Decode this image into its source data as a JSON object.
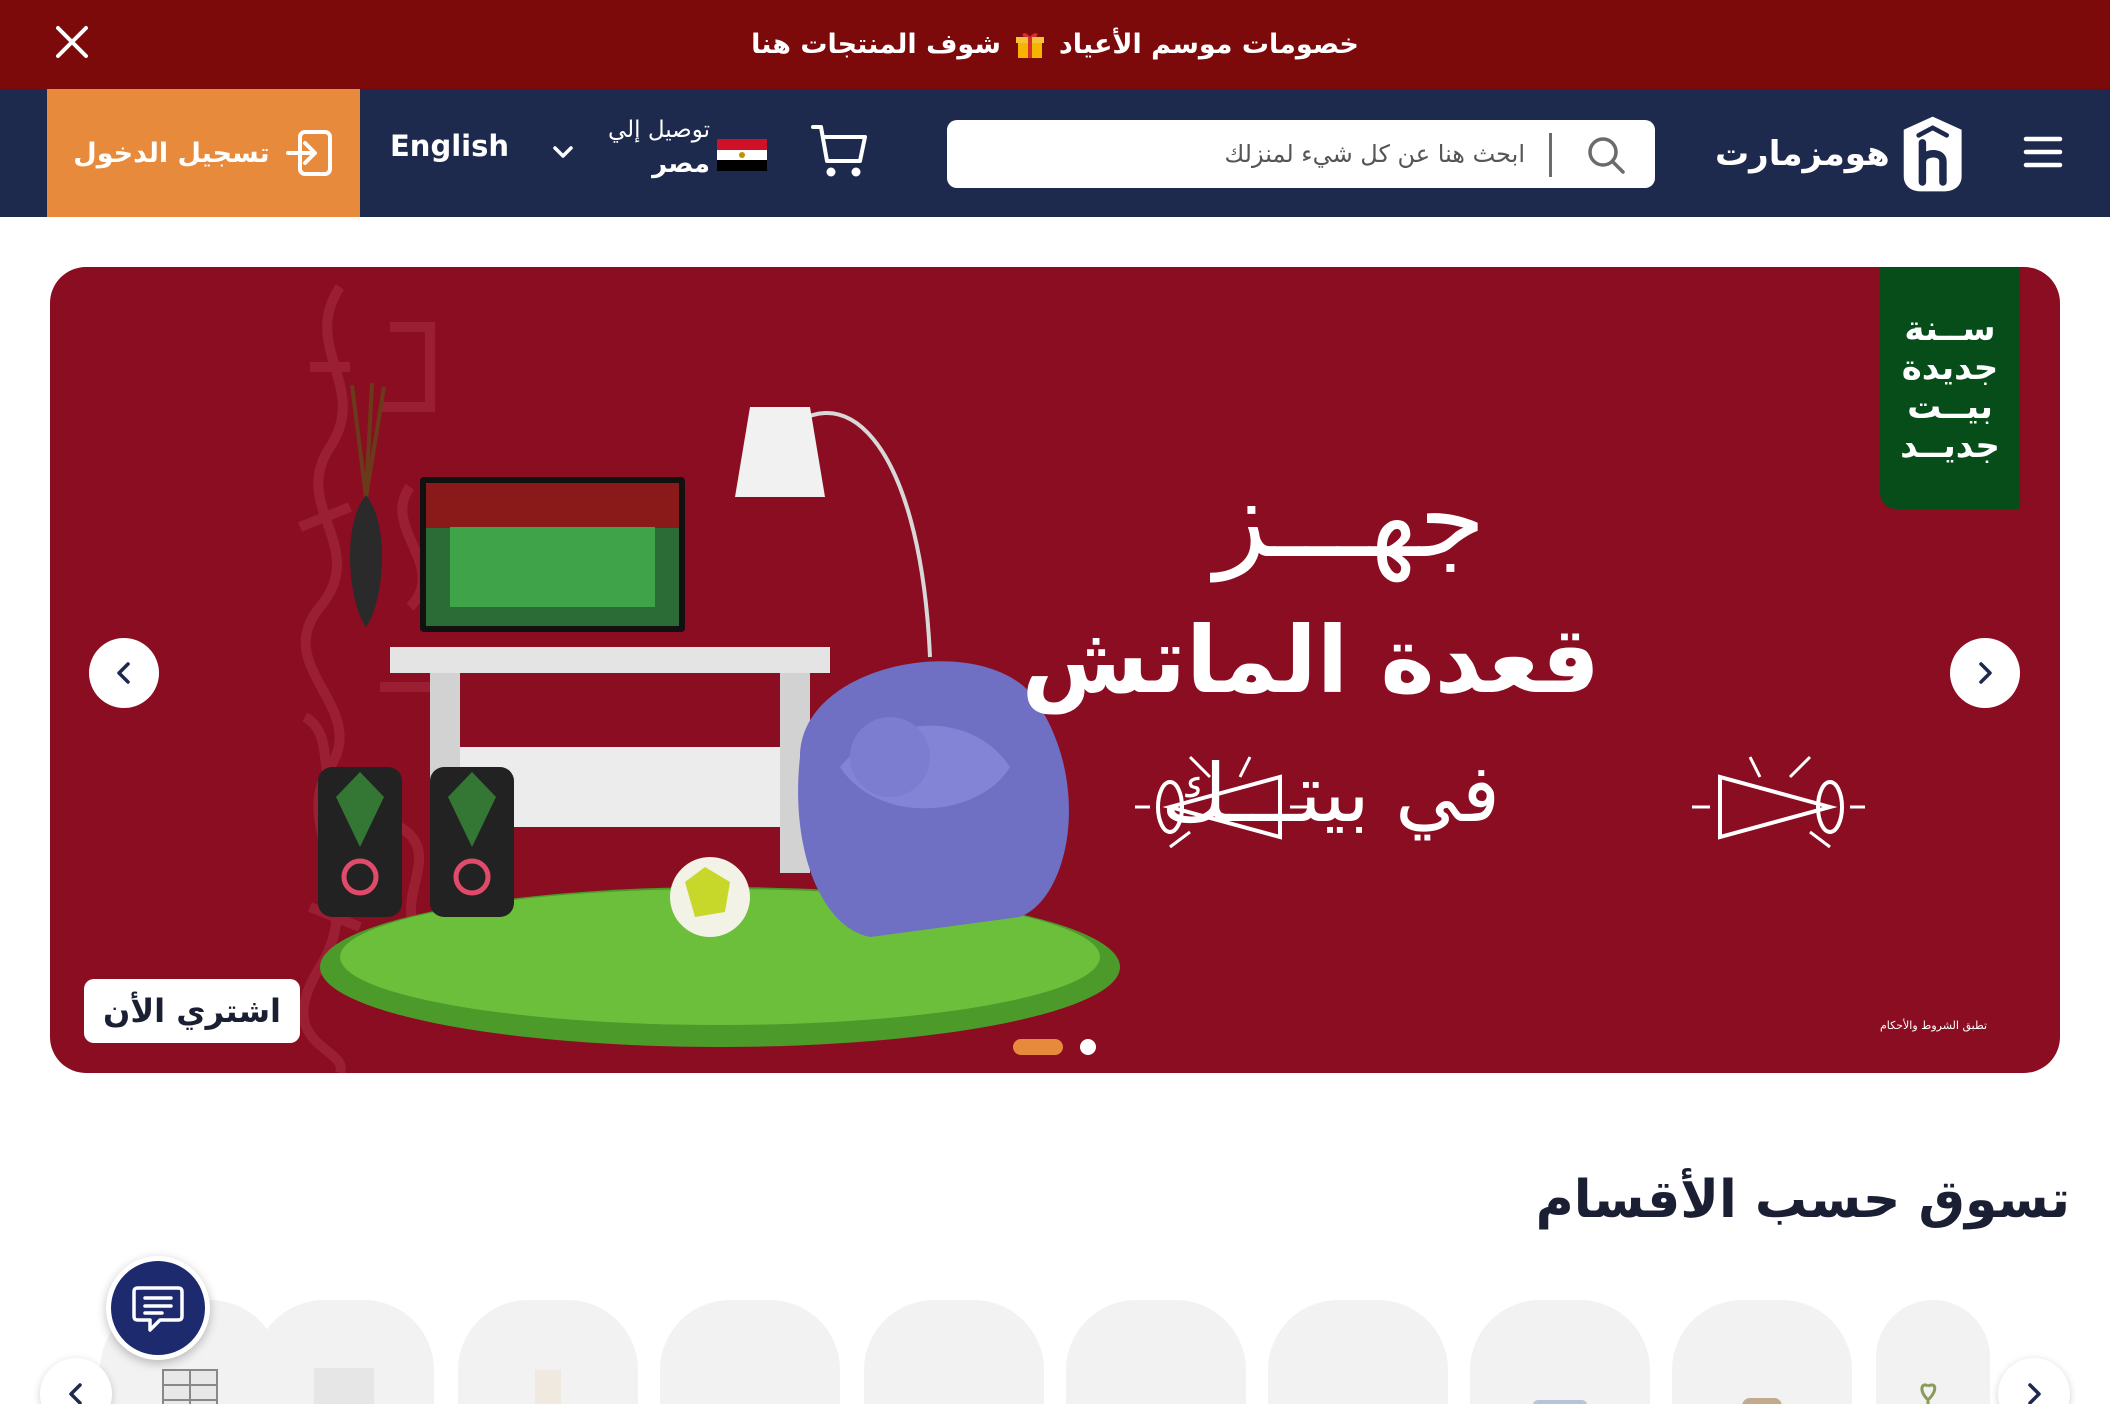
{
  "promo": {
    "text_before": "خصومات موسم الأعياد",
    "text_after": "شوف المنتجات هنا",
    "gift_icon": "gift-icon",
    "close_icon": "close-icon"
  },
  "header": {
    "logo_text": "هومزمارت",
    "search_placeholder": "ابحث هنا عن كل شيء لمنزلك",
    "delivery_label": "توصيل إلي",
    "delivery_country": "مصر",
    "language": "English",
    "login_label": "تسجيل الدخول",
    "icons": [
      "menu-icon",
      "search-icon",
      "cart-icon",
      "egypt-flag-icon",
      "chevron-down-icon",
      "login-icon"
    ]
  },
  "banner": {
    "badge_lines": [
      "ســنة",
      "جديدة",
      "بيــت",
      "جديــد"
    ],
    "headline_1": "جهـــز",
    "headline_2": "قعدة الماتش",
    "headline_3": "في بيتـــك",
    "terms": "تطبق الشروط والأحكام",
    "buy_button": "اشتري الأن",
    "slide_count": 2,
    "active_slide": 1
  },
  "categories": {
    "title": "تسوق حسب الأقسام",
    "visible_cards": 10
  },
  "colors": {
    "promo_bg": "#7d0a0a",
    "header_bg": "#1d2a4d",
    "login_bg": "#e88a3c",
    "banner_bg": "#8a0d22",
    "badge_bg": "#064d1a",
    "chat_bg": "#1d2a6e"
  }
}
